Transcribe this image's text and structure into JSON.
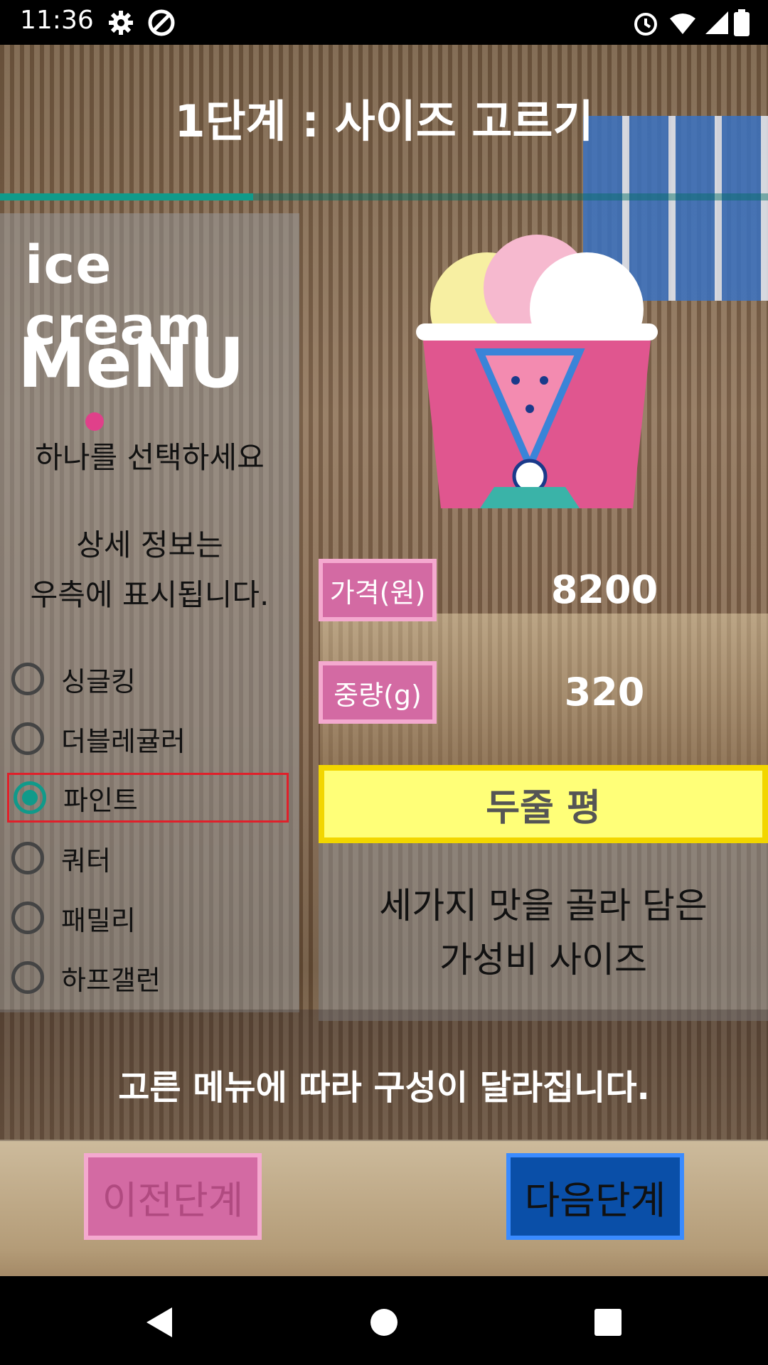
{
  "status_bar": {
    "time": "11:36",
    "icons": [
      "gear-icon",
      "no-disturb-icon",
      "alarm-icon",
      "wifi-icon",
      "signal-icon",
      "battery-icon"
    ]
  },
  "header": {
    "title": "1단계 : 사이즈 고르기",
    "progress": 0.33
  },
  "left_panel": {
    "logo_line1": "ice cream",
    "logo_line2": "MeNU",
    "choose_prompt": "하나를 선택하세요",
    "detail_line1": "상세 정보는",
    "detail_line2": "우측에 표시됩니다.",
    "options": [
      {
        "label": "싱글킹",
        "selected": false
      },
      {
        "label": "더블레귤러",
        "selected": false
      },
      {
        "label": "파인트",
        "selected": true
      },
      {
        "label": "쿼터",
        "selected": false
      },
      {
        "label": "패밀리",
        "selected": false
      },
      {
        "label": "하프갤런",
        "selected": false
      }
    ]
  },
  "details": {
    "price_label": "가격(원)",
    "price_value": "8200",
    "weight_label": "중량(g)",
    "weight_value": "320",
    "review_title": "두줄 평",
    "review_line1": "세가지 맛을 골라 담은",
    "review_line2": "가성비 사이즈"
  },
  "footer": {
    "note": "고른 메뉴에 따라 구성이 달라집니다.",
    "prev_label": "이전단계",
    "next_label": "다음단계"
  },
  "colors": {
    "accent": "#109a8a",
    "pink": "#d36aa3",
    "blue": "#0a4fa8",
    "yellow": "#ffff78",
    "highlight_border": "#e0202a"
  }
}
